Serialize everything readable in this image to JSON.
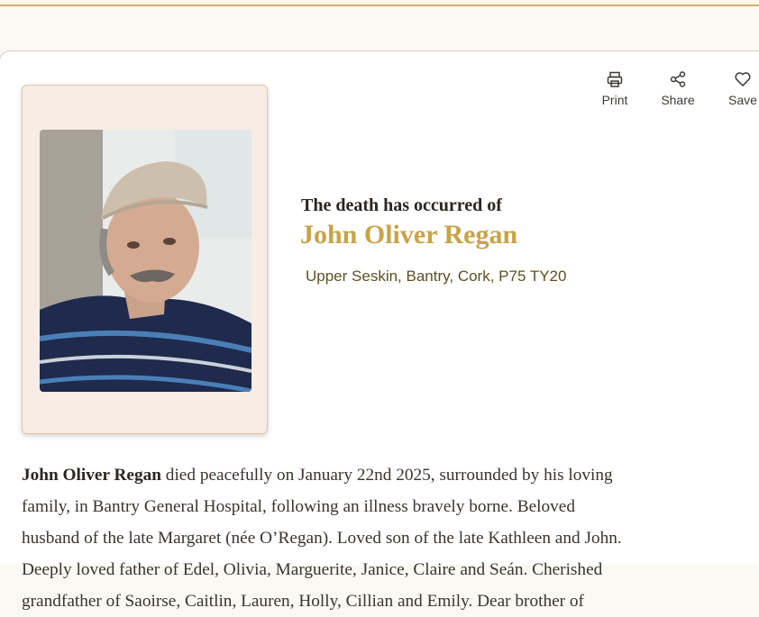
{
  "header": {
    "accent_color": "#d6b45a"
  },
  "actions": [
    {
      "label": "Print",
      "icon": "printer-icon"
    },
    {
      "label": "Share",
      "icon": "share-icon"
    },
    {
      "label": "Save",
      "icon": "heart-icon"
    }
  ],
  "notice": {
    "intro": "The death has occurred of",
    "name": "John Oliver Regan",
    "address": "Upper Seskin, Bantry, Cork, P75 TY20",
    "name_color": "#c9a345",
    "body": {
      "line1_bold": "John Oliver Regan",
      "line1_rest": " died peacefully on January 22nd 2025, surrounded by his loving",
      "line2": "family, in Bantry General Hospital, following an illness bravely borne. Beloved",
      "line3": "husband of the late Margaret (née O’Regan). Loved son of the late Kathleen and John.",
      "line4": "Deeply loved father of Edel, Olivia, Marguerite, Janice, Claire and Seán. Cherished",
      "line5": "grandfather of Saoirse, Caitlin, Lauren, Holly, Cillian and Emily. Dear brother of"
    }
  }
}
